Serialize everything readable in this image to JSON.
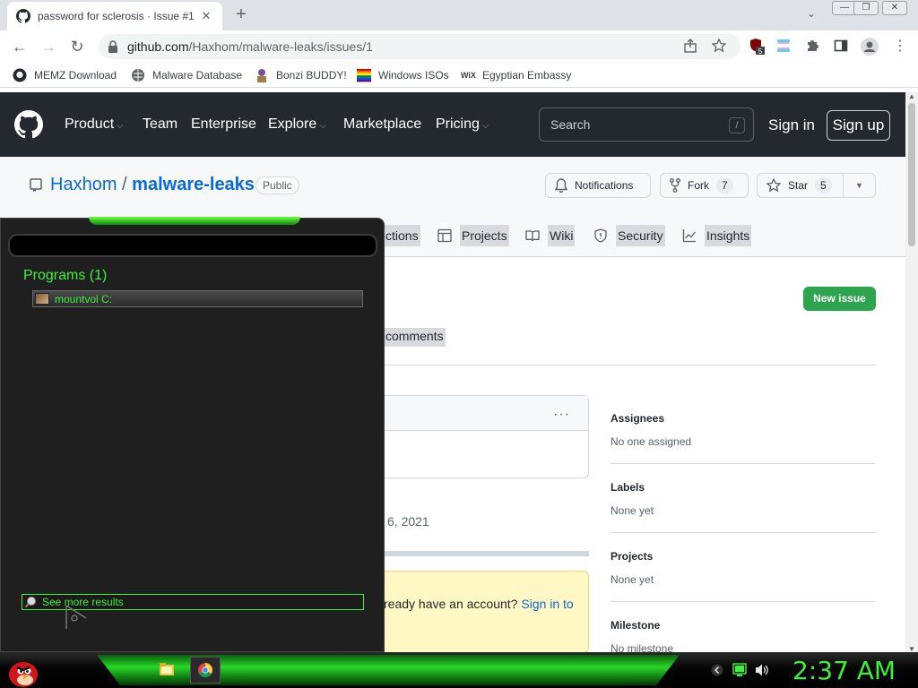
{
  "browser": {
    "tab_title": "password for sclerosis · Issue #1",
    "tab_close": "✕",
    "new_tab": "+",
    "url_host": "github.com",
    "url_path": "/Haxhom/malware-leaks/issues/1",
    "extension_badge": "5",
    "bookmarks": [
      {
        "label": "MEMZ Download",
        "icon": "github-icon"
      },
      {
        "label": "Malware Database",
        "icon": "globe-icon"
      },
      {
        "label": "Bonzi BUDDY!",
        "icon": "bonzi-icon"
      },
      {
        "label": "Windows ISOs",
        "icon": "windows-flag-icon"
      },
      {
        "label": "Egyptian Embassy",
        "icon": "wix-icon"
      }
    ]
  },
  "github": {
    "nav": {
      "product": "Product",
      "team": "Team",
      "enterprise": "Enterprise",
      "explore": "Explore",
      "marketplace": "Marketplace",
      "pricing": "Pricing",
      "search_placeholder": "Search",
      "search_key": "/",
      "sign_in": "Sign in",
      "sign_up": "Sign up"
    },
    "repo": {
      "owner": "Haxhom",
      "separator": "/",
      "name": "malware-leaks",
      "visibility": "Public",
      "notifications": "Notifications",
      "fork": "Fork",
      "fork_count": "7",
      "star": "Star",
      "star_count": "5"
    },
    "tabs": {
      "actions_partial": "ctions",
      "projects": "Projects",
      "wiki": "Wiki",
      "security": "Security",
      "insights": "Insights"
    },
    "issue": {
      "new_issue": "New issue",
      "comments": "comments",
      "comment_menu": "···",
      "date_partial": "6, 2021",
      "signup_prompt": "ready have an account?",
      "signup_link": "Sign in to"
    },
    "sidebar": [
      {
        "heading": "Assignees",
        "value": "No one assigned"
      },
      {
        "heading": "Labels",
        "value": "None yet"
      },
      {
        "heading": "Projects",
        "value": "None yet"
      },
      {
        "heading": "Milestone",
        "value": "No milestone"
      }
    ]
  },
  "start_menu": {
    "programs_heading": "Programs (1)",
    "result_item": "mountvol C:",
    "see_more": "See more results"
  },
  "taskbar": {
    "clock": "2:37 AM"
  },
  "colors": {
    "github_header": "#24292f",
    "link_blue": "#0969da",
    "new_issue_green": "#2da44e",
    "start_menu_green": "#3cf03c",
    "taskbar_green": "#29d629"
  }
}
